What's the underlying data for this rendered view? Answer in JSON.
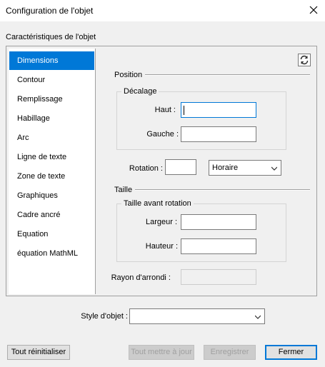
{
  "window": {
    "title": "Configuration de l'objet",
    "close_icon": "close-icon"
  },
  "group_label": "Caractéristiques de l'objet",
  "sidebar": {
    "selected_index": 0,
    "items": [
      {
        "label": "Dimensions"
      },
      {
        "label": "Contour"
      },
      {
        "label": "Remplissage"
      },
      {
        "label": "Habillage"
      },
      {
        "label": "Arc"
      },
      {
        "label": "Ligne de texte"
      },
      {
        "label": "Zone de texte"
      },
      {
        "label": "Graphiques"
      },
      {
        "label": "Cadre ancré"
      },
      {
        "label": "Equation"
      },
      {
        "label": "équation MathML"
      }
    ]
  },
  "position": {
    "section_title": "Position",
    "offset_title": "Décalage",
    "top_label": "Haut :",
    "top_value": "",
    "left_label": "Gauche :",
    "left_value": ""
  },
  "rotation": {
    "label": "Rotation :",
    "value": "",
    "direction_selected": "Horaire"
  },
  "size": {
    "section_title": "Taille",
    "group_title": "Taille avant rotation",
    "width_label": "Largeur :",
    "width_value": "",
    "height_label": "Hauteur :",
    "height_value": ""
  },
  "corner_radius": {
    "label": "Rayon d'arrondi :",
    "value": ""
  },
  "object_style": {
    "label": "Style d'objet :",
    "value": ""
  },
  "buttons": {
    "reset": "Tout réinitialiser",
    "update_all": "Tout mettre à jour",
    "save": "Enregistrer",
    "close": "Fermer"
  },
  "colors": {
    "selection": "#0078d7",
    "focus_border": "#0078d7"
  }
}
